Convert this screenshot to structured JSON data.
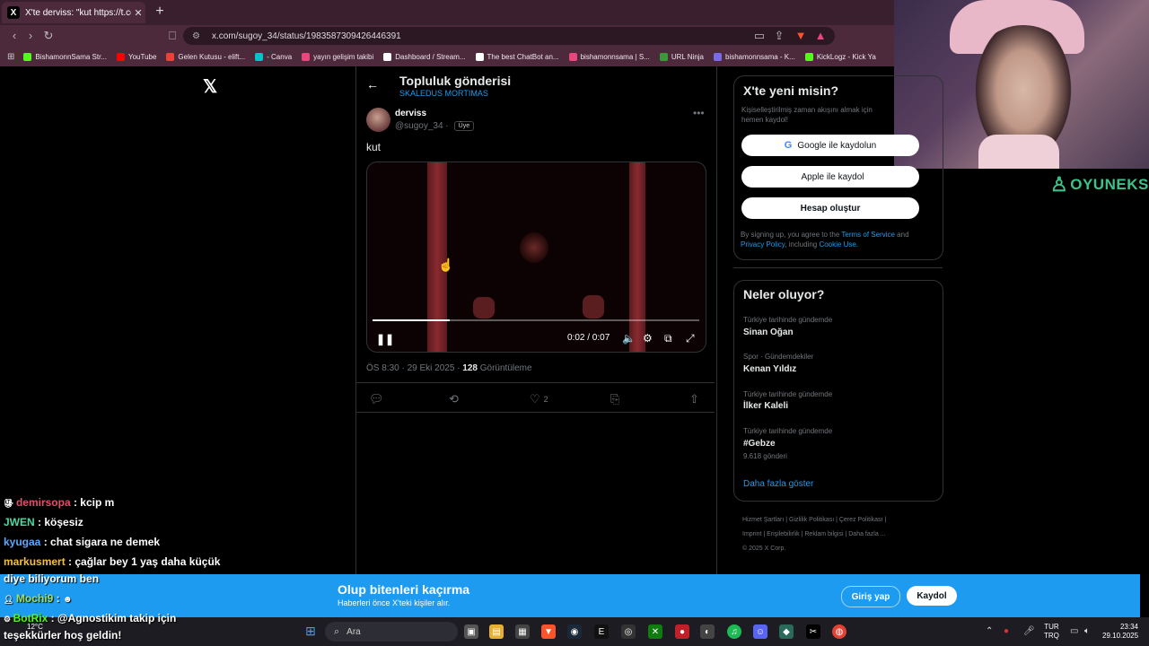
{
  "browser": {
    "tab_title": "X'te derviss: \"kut https://t.co/",
    "tab_favicon": "X",
    "tab_close": "✕",
    "new_tab": "+",
    "url": "x.com/sugoy_34/status/1983587309426446391",
    "bookmarks": [
      {
        "label": "BishamonnSama Str...",
        "color": "#53fc18"
      },
      {
        "label": "YouTube",
        "color": "#ff0000"
      },
      {
        "label": "Gelen Kutusu - elift...",
        "color": "#ea4335"
      },
      {
        "label": "- Canva",
        "color": "#00c4cc"
      },
      {
        "label": "yayın gelişim takibi",
        "color": "#e8467c"
      },
      {
        "label": "Dashboard / Stream...",
        "color": "#ffffff"
      },
      {
        "label": "The best ChatBot an...",
        "color": "#ffffff"
      },
      {
        "label": "bishamonnsama | S...",
        "color": "#e8467c"
      },
      {
        "label": "URL Ninja",
        "color": "#3a9a3a"
      },
      {
        "label": "bishamonnsama - K...",
        "color": "#7a6ae8"
      },
      {
        "label": "KickLogz - Kick Ya",
        "color": "#53fc18"
      }
    ]
  },
  "overlay": {
    "brand": "OYUNEKS"
  },
  "x": {
    "header_title": "Topluluk gönderisi",
    "header_subtitle": "SKALEDUS MORTIMAS",
    "author_name": "derviss",
    "author_handle": "@sugoy_34 ·",
    "member_badge": "Üye",
    "tweet_text": "kut",
    "video": {
      "time": "0:02 / 0:07",
      "progress": 0.235
    },
    "meta_time": "ÖS 8:30 · 29 Eki 2025 · ",
    "meta_views": "128",
    "meta_views_label": " Görüntüleme",
    "likes": "2"
  },
  "signup": {
    "title": "X'te yeni misin?",
    "desc": "Kişiselleştirilmiş zaman akışını almak için hemen kaydol!",
    "google": "Google ile kaydolun",
    "apple": "Apple ile kaydol",
    "create": "Hesap oluştur",
    "legal_prefix": "By signing up, you agree to the ",
    "terms": "Terms of Service",
    "and": " and ",
    "privacy": "Privacy Policy",
    "including": ", including ",
    "cookie": "Cookie Use."
  },
  "trends": {
    "title": "Neler oluyor?",
    "items": [
      {
        "context": "Türkiye tarihinde gündemde",
        "name": "Sinan Oğan",
        "count": ""
      },
      {
        "context": "Spor · Gündemdekiler",
        "name": "Kenan Yıldız",
        "count": ""
      },
      {
        "context": "Türkiye tarihinde gündemde",
        "name": "İlker Kaleli",
        "count": ""
      },
      {
        "context": "Türkiye tarihinde gündemde",
        "name": "#Gebze",
        "count": "9.618 gönderi"
      }
    ],
    "more": "Daha fazla göster"
  },
  "footer": {
    "line1": "Hizmet Şartları  |  Gizlilik Politikası  |  Çerez Politikası  |",
    "line2": "Imprint  |  Erişilebilirlik  |  Reklam bilgisi  |  Daha fazla ...",
    "line3": "© 2025 X Corp."
  },
  "banner": {
    "title": "Olup bitenleri kaçırma",
    "subtitle": "Haberleri önce X'teki kişiler alır.",
    "login": "Giriş yap",
    "signup": "Kaydol"
  },
  "chat": [
    {
      "user": "demirsopa",
      "color": "#e0506a",
      "msg": " : kcip m"
    },
    {
      "user": "JWEN",
      "color": "#4cd8a0",
      "msg": " : köşesiz"
    },
    {
      "user": "kyugaa",
      "color": "#5aa8ff",
      "msg": " : chat sigara ne demek"
    },
    {
      "user": "markusmert",
      "color": "#f0c040",
      "msg": " : çağlar bey 1 yaş daha küçük"
    },
    {
      "user": "",
      "color": "#ffffff",
      "msg": "diye biliyorum ben"
    },
    {
      "user": "Mochi9",
      "color": "#a0e060",
      "msg": " : "
    },
    {
      "user": "BotRix",
      "color": "#53fc18",
      "msg": " : @Agnostikim takip için"
    },
    {
      "user": "",
      "color": "#ffffff",
      "msg": "teşekkürler hoş geldin!"
    }
  ],
  "taskbar": {
    "search": "Ara",
    "weather": "12°C",
    "lang_top": "TUR",
    "lang_bottom": "TRQ",
    "time": "23:34",
    "date": "29.10.2025"
  }
}
